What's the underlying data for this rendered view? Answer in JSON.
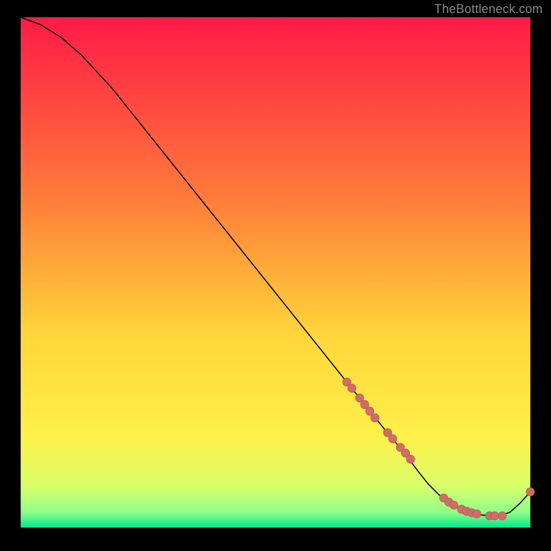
{
  "attribution": "TheBottleneck.com",
  "colors": {
    "black": "#000000",
    "curve": "#000000",
    "marker_fill": "#cf6d68",
    "marker_stroke": "#b65a55",
    "grad_top": "#ff1a47",
    "grad_upper": "#ff7a3a",
    "grad_mid": "#ffd53a",
    "grad_low1": "#fff04a",
    "grad_low2": "#d8ff6a",
    "grad_low3": "#8fff8a",
    "grad_bottom": "#00e88a"
  },
  "chart_data": {
    "type": "line",
    "title": "",
    "xlabel": "",
    "ylabel": "",
    "xlim": [
      0,
      100
    ],
    "ylim": [
      0,
      100
    ],
    "series": [
      {
        "name": "curve",
        "x": [
          0,
          4,
          8,
          12,
          18,
          26,
          34,
          42,
          50,
          58,
          64,
          68,
          72,
          75,
          78,
          80,
          82,
          84,
          86,
          88,
          90,
          92,
          94,
          96,
          98,
          100
        ],
        "y": [
          100,
          98.5,
          96,
          92.5,
          86,
          76,
          66,
          56,
          46,
          36,
          28.5,
          23.5,
          18.5,
          15,
          11,
          8.5,
          6.5,
          5,
          3.8,
          3,
          2.5,
          2.3,
          2.3,
          3,
          4.8,
          7
        ]
      }
    ],
    "markers": [
      {
        "x": 64.0,
        "y": 28.5
      },
      {
        "x": 65.0,
        "y": 27.3
      },
      {
        "x": 66.5,
        "y": 25.4
      },
      {
        "x": 67.5,
        "y": 24.1
      },
      {
        "x": 68.5,
        "y": 22.8
      },
      {
        "x": 69.5,
        "y": 21.5
      },
      {
        "x": 72.0,
        "y": 18.6
      },
      {
        "x": 73.0,
        "y": 17.4
      },
      {
        "x": 74.5,
        "y": 15.7
      },
      {
        "x": 75.5,
        "y": 14.6
      },
      {
        "x": 76.5,
        "y": 13.4
      },
      {
        "x": 83.0,
        "y": 5.8
      },
      {
        "x": 84.0,
        "y": 5.0
      },
      {
        "x": 85.0,
        "y": 4.4
      },
      {
        "x": 86.5,
        "y": 3.6
      },
      {
        "x": 87.5,
        "y": 3.2
      },
      {
        "x": 88.5,
        "y": 2.9
      },
      {
        "x": 89.5,
        "y": 2.7
      },
      {
        "x": 92.0,
        "y": 2.3
      },
      {
        "x": 93.0,
        "y": 2.3
      },
      {
        "x": 94.5,
        "y": 2.3
      },
      {
        "x": 100.0,
        "y": 7.0
      }
    ]
  }
}
